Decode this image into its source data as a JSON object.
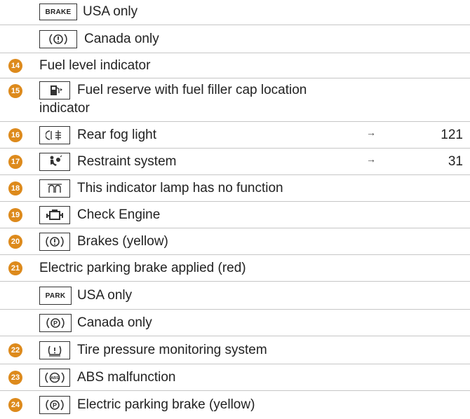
{
  "rows": [
    {
      "label": "USA only",
      "icon_text": "BRAKE"
    },
    {
      "label": "Canada only",
      "icon_text": "(!)"
    },
    {
      "number": "14",
      "label": "Fuel level indicator"
    },
    {
      "number": "15",
      "label_line1": "Fuel reserve with fuel filler cap location",
      "label_line2": "indicator"
    },
    {
      "number": "16",
      "label": "Rear fog light",
      "arrow": "→",
      "page": "121"
    },
    {
      "number": "17",
      "label": "Restraint system",
      "arrow": "→",
      "page": "31"
    },
    {
      "number": "18",
      "label": "This indicator lamp has no function"
    },
    {
      "number": "19",
      "label": "Check Engine"
    },
    {
      "number": "20",
      "label": "Brakes (yellow)",
      "icon_text": "(!)"
    },
    {
      "number": "21",
      "label": "Electric parking brake applied (red)"
    },
    {
      "label": "USA only",
      "icon_text": "PARK"
    },
    {
      "label": "Canada only",
      "icon_text": "(P)"
    },
    {
      "number": "22",
      "label": "Tire pressure monitoring system",
      "icon_text": "(!)"
    },
    {
      "number": "23",
      "label": "ABS malfunction",
      "icon_text": "ABS"
    },
    {
      "number": "24",
      "label": "Electric parking brake (yellow)",
      "icon_text": "(P)"
    }
  ],
  "colors": {
    "number_badge": "#dd8a1c",
    "divider": "#c6c6c6",
    "text": "#222222"
  },
  "icons": [
    "brake-warning-icon",
    "fuel-pump-icon",
    "rear-fog-light-icon",
    "airbag-icon",
    "glow-plug-icon",
    "check-engine-icon",
    "parking-brake-icon",
    "tire-pressure-icon",
    "abs-icon"
  ]
}
